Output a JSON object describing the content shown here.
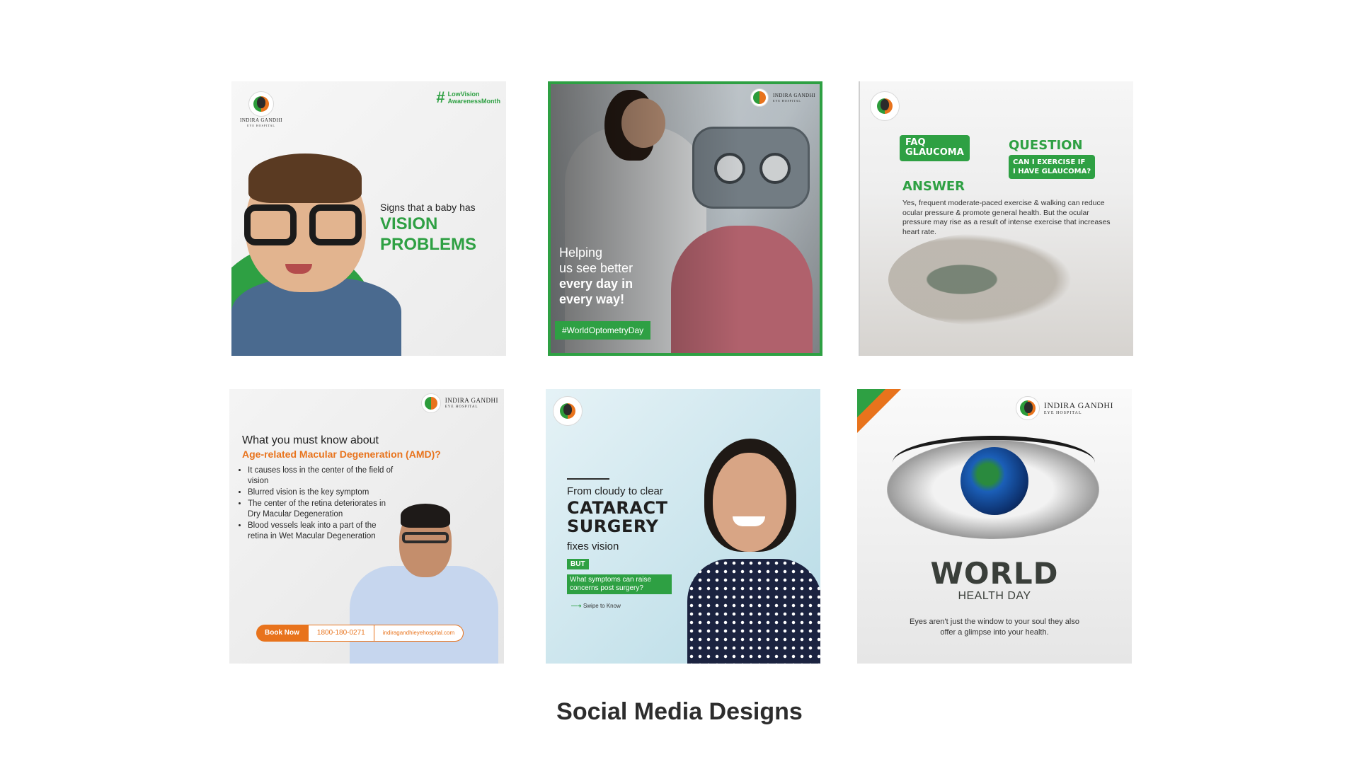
{
  "colors": {
    "green": "#2ea043",
    "orange": "#e8731c",
    "text": "#2d2d2d"
  },
  "brand": {
    "logo_line1": "INDIRA GANDHI",
    "logo_line2": "EYE HOSPITAL"
  },
  "tiles": [
    {
      "tag_line1": "LowVision",
      "tag_line2": "AwarenessMonth",
      "subtitle": "Signs that a baby has",
      "title_line1": "VISION",
      "title_line2": "PROBLEMS"
    },
    {
      "line1": "Helping",
      "line2": "us see better",
      "line3": "every day in",
      "line4": "every way!",
      "hashtag": "#WorldOptometryDay"
    },
    {
      "faq_line1": "FAQ",
      "faq_line2": "GLAUCOMA",
      "question_label": "QUESTION",
      "question_line1": "CAN I EXERCISE IF",
      "question_line2": "I HAVE GLAUCOMA?",
      "answer_label": "ANSWER",
      "answer_text": "Yes, frequent moderate-paced exercise & walking can reduce ocular pressure & promote general health. But the ocular pressure may rise as a result of intense exercise that increases heart rate."
    },
    {
      "heading": "What you must know about",
      "subheading": "Age-related Macular Degeneration (AMD)?",
      "bullets": [
        "It causes loss in the center of the field of vision",
        "Blurred vision is the key symptom",
        "The center of the retina deteriorates in Dry Macular Degeneration",
        "Blood vessels leak into a part of the retina in Wet Macular Degeneration"
      ],
      "book_label": "Book Now",
      "phone": "1800-180-0271",
      "website": "indiragandhieyehospital.com"
    },
    {
      "line1": "From cloudy to clear",
      "line2a": "CATARACT",
      "line2b": "SURGERY",
      "line3": "fixes vision",
      "but": "BUT",
      "question": "What symptoms can raise concerns post surgery?",
      "swipe": "Swipe to Know"
    },
    {
      "world": "WORLD",
      "health_day": "HEALTH DAY",
      "caption_line1": "Eyes aren't just the window to your soul they also",
      "caption_line2": "offer a glimpse into your health."
    }
  ],
  "page_title": "Social Media Designs"
}
